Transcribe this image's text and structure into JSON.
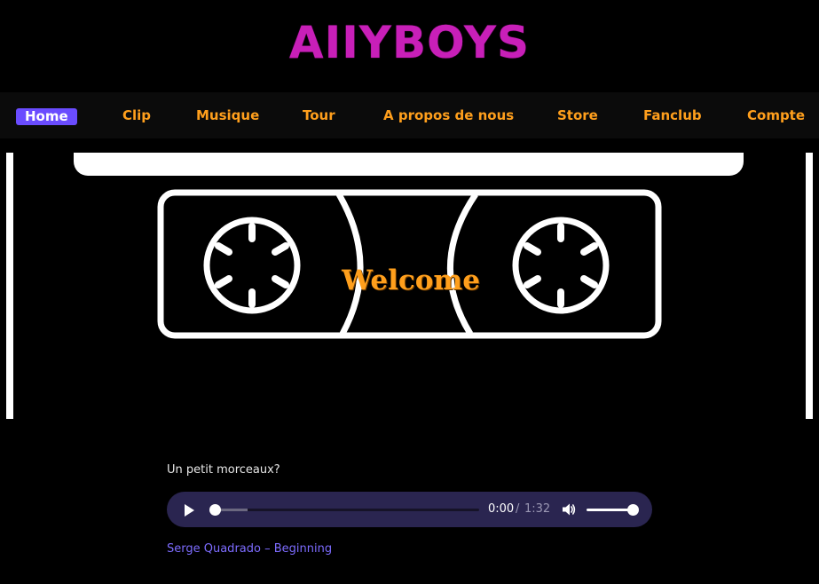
{
  "site": {
    "logo": "AIIYBOYS"
  },
  "nav": {
    "items": [
      {
        "label": "Home",
        "active": true
      },
      {
        "label": "Clip"
      },
      {
        "label": "Musique"
      },
      {
        "label": "Tour"
      },
      {
        "label": "A propos de nous"
      },
      {
        "label": "Store"
      },
      {
        "label": "Fanclub"
      },
      {
        "label": "Compte"
      }
    ]
  },
  "hero": {
    "welcome": "Welcome",
    "icon": "cassette-tape-icon"
  },
  "music": {
    "intro": "Un petit morceaux?",
    "player": {
      "current_time": "0:00",
      "separator": "/",
      "duration": "1:32",
      "progress": 0,
      "volume": 1.0,
      "play_icon": "play-icon",
      "volume_icon": "volume-icon"
    },
    "track_credit": "Serge Quadrado – Beginning"
  },
  "colors": {
    "logo": "#c81fb8",
    "nav_text": "#ff9f1c",
    "nav_active_bg": "#6a4cff",
    "player_bg": "#2a2550",
    "link": "#7d6cff",
    "background": "#000000"
  }
}
